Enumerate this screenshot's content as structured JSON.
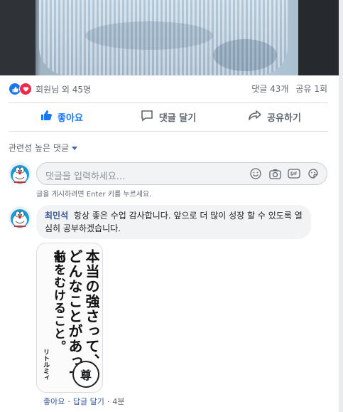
{
  "post": {
    "reactions_text": "회원님 외 45명",
    "comments_count": "댓글 43개",
    "shares_count": "공유 1회",
    "actions": {
      "like": "좋아요",
      "comment": "댓글 달기",
      "share": "공유하기"
    }
  },
  "comments": {
    "sort_label": "관련성 높은 댓글",
    "input_placeholder": "댓글을 입력하세요...",
    "input_hint": "글을 게시하려면 Enter 키를 누르세요.",
    "items": [
      {
        "author": "최민석",
        "text": "항상 좋은 수업 감사합니다. 앞으로 더 많이 성장 할 수 있도록 열심히 공부하겠습니다.",
        "sticker_lines": [
          "本当の強さって、",
          "どんなことがあっても",
          "前をむけること。"
        ],
        "sticker_signature": "リトルミィ",
        "sticker_seal": "尊",
        "actions": {
          "like": "좋아요",
          "reply": "답글 달기",
          "time": "4분"
        }
      }
    ]
  },
  "colors": {
    "accent": "#1877f2",
    "love": "#f0284a",
    "link": "#385898",
    "muted": "#606770"
  },
  "icons": [
    "like-reaction-icon",
    "love-reaction-icon",
    "thumbs-up-icon",
    "comment-icon",
    "share-icon",
    "caret-down-icon",
    "emoji-icon",
    "camera-icon",
    "gif-icon",
    "sticker-icon",
    "doraemon-avatar"
  ]
}
